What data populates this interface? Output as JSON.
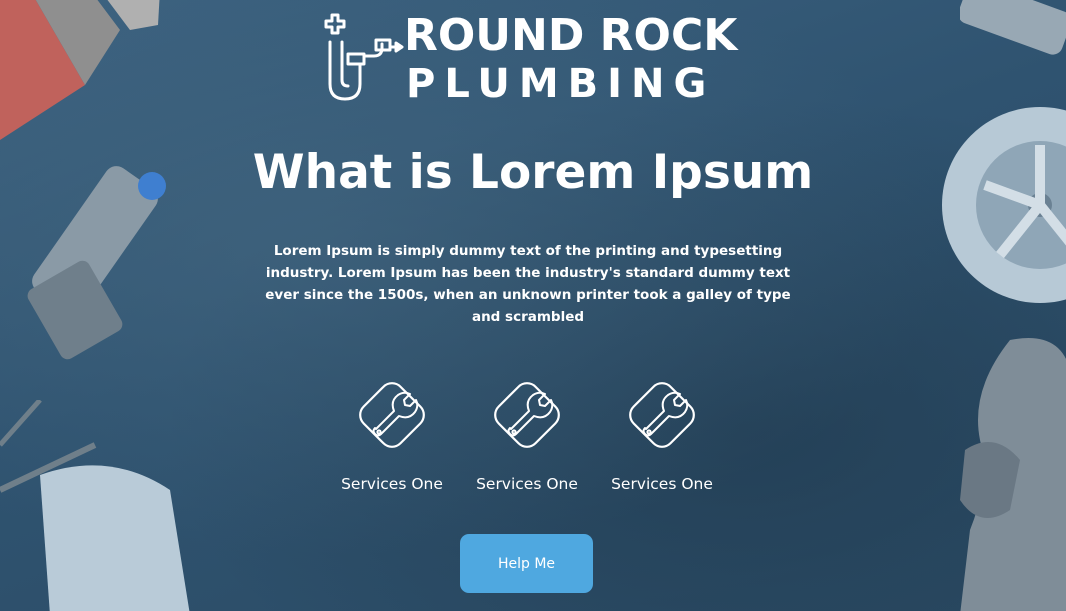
{
  "brand": {
    "line1": "ROUND ROCK",
    "line2": "PLUMBING",
    "logo_icon": "pipe-logo-icon"
  },
  "hero": {
    "title": "What is Lorem Ipsum",
    "body": "Lorem Ipsum is simply dummy text of the printing and typesetting industry. Lorem Ipsum has been the industry's standard dummy text ever since the 1500s, when an unknown printer took a galley of type and scrambled"
  },
  "services": [
    {
      "label": "Services One",
      "icon": "wrench-icon"
    },
    {
      "label": "Services One",
      "icon": "wrench-icon"
    },
    {
      "label": "Services One",
      "icon": "wrench-icon"
    }
  ],
  "cta": {
    "label": "Help Me"
  },
  "colors": {
    "overlay": "#345872",
    "button": "#4fa8e0",
    "text": "#ffffff"
  }
}
